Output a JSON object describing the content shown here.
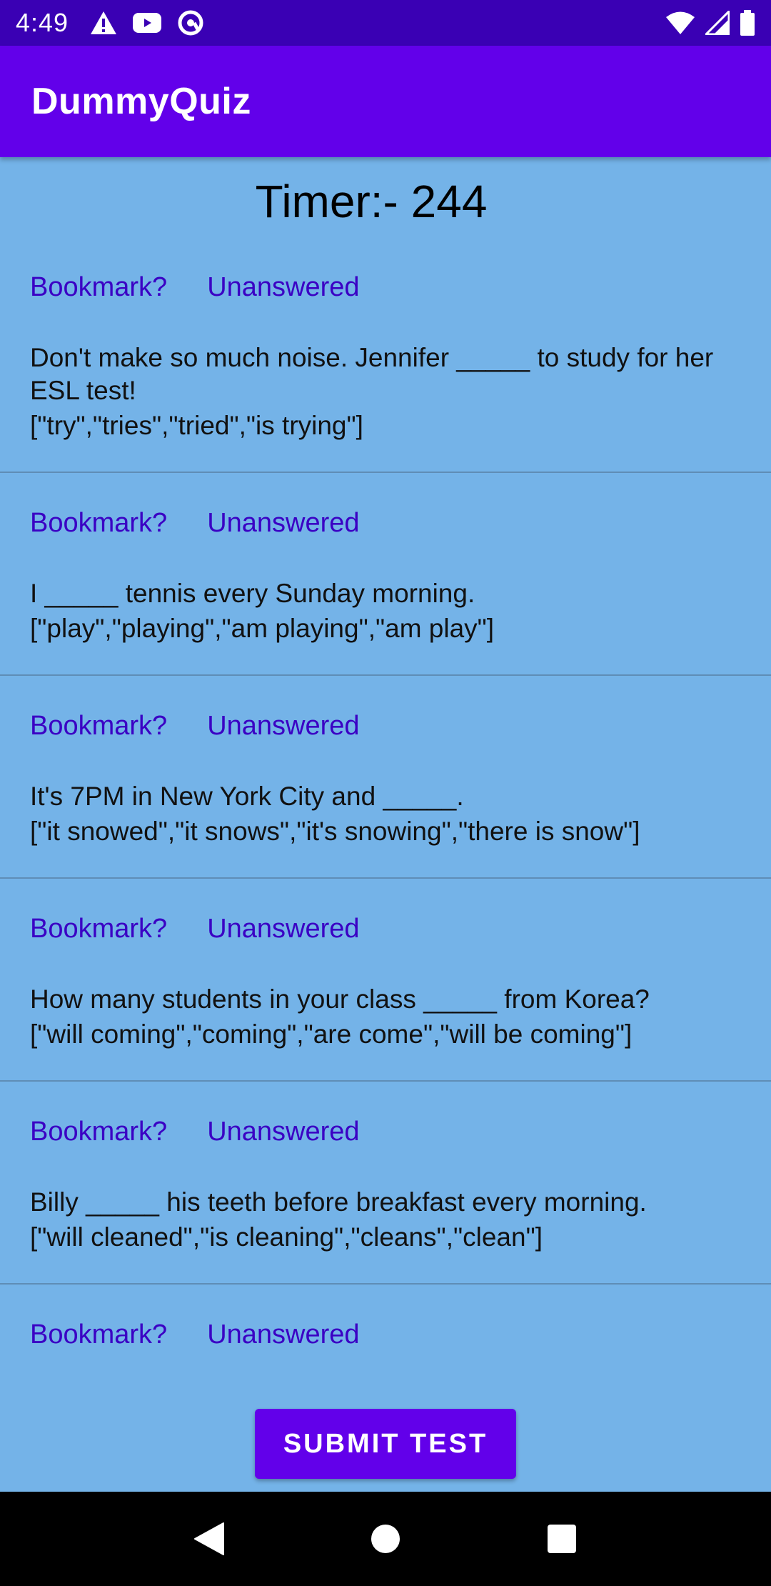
{
  "status_bar": {
    "time": "4:49",
    "left_icons": [
      "warning-icon",
      "youtube-icon",
      "at-sign-icon"
    ],
    "right_icons": [
      "wifi-icon",
      "signal-icon",
      "battery-icon"
    ]
  },
  "app_bar": {
    "title": "DummyQuiz"
  },
  "timer": {
    "text": "Timer:- 244"
  },
  "questions": [
    {
      "bookmark_label": "Bookmark?",
      "status_label": "Unanswered",
      "text": "Don't make so much noise. Jennifer _____ to study for her ESL test!",
      "options": "[\"try\",\"tries\",\"tried\",\"is trying\"]"
    },
    {
      "bookmark_label": "Bookmark?",
      "status_label": "Unanswered",
      "text": "I _____ tennis every Sunday morning.",
      "options": "[\"play\",\"playing\",\"am playing\",\"am play\"]"
    },
    {
      "bookmark_label": "Bookmark?",
      "status_label": "Unanswered",
      "text": "It's 7PM in New York City and _____.",
      "options": "[\"it snowed\",\"it snows\",\"it's snowing\",\"there is snow\"]"
    },
    {
      "bookmark_label": "Bookmark?",
      "status_label": "Unanswered",
      "text": "How many students in your class _____ from Korea?",
      "options": "[\"will coming\",\"coming\",\"are come\",\"will be coming\"]"
    },
    {
      "bookmark_label": "Bookmark?",
      "status_label": "Unanswered",
      "text": "Billy _____ his teeth before breakfast every morning.",
      "options": "[\"will cleaned\",\"is cleaning\",\"cleans\",\"clean\"]"
    },
    {
      "bookmark_label": "Bookmark?",
      "status_label": "Unanswered"
    }
  ],
  "submit_button": {
    "label": "SUBMIT TEST"
  },
  "nav_bar": {
    "icons": [
      "back-icon",
      "home-icon",
      "recents-icon"
    ]
  },
  "colors": {
    "status_bar": "#3a00b4",
    "app_bar": "#6200ea",
    "background": "#74b3e8",
    "link": "#3a00c4",
    "button": "#6200ea"
  }
}
